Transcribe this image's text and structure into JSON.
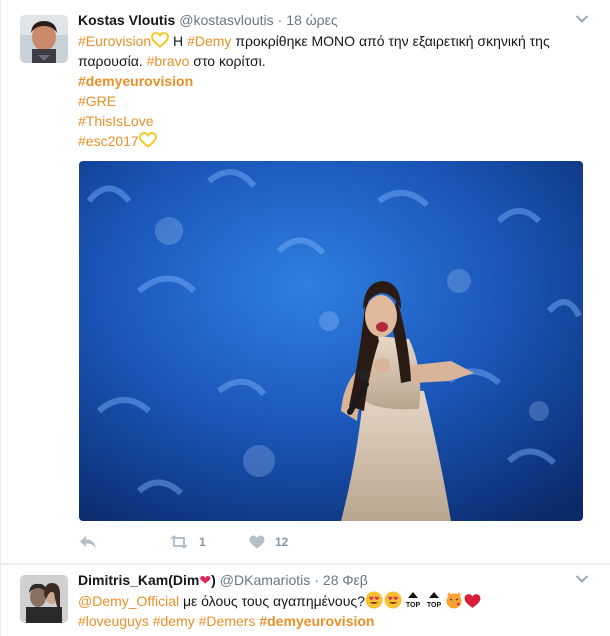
{
  "tweets": [
    {
      "fullname": "Kostas Vloutis",
      "username": "@kostasvloutis",
      "time": "18 ώρες",
      "line1_tag1": "#Eurovision",
      "line1_h": "Η",
      "line1_tag2": "#Demy",
      "line1_rest": "προκρίθηκε ΜΟΝΟ από την εξαιρετική σκηνική της",
      "line2_a": "παρουσία.",
      "line2_tag": "#bravo",
      "line2_rest": "στο κορίτσι.",
      "tag_bold": "#demyeurovision",
      "tag_gre": "#GRE",
      "tag_love": "#ThisIsLove",
      "tag_esc": "#esc2017",
      "reply_count": "",
      "retweet_count": "1",
      "like_count": "12"
    },
    {
      "fullname": "Dimitris_Kam(Dim",
      "fullname_close": ")",
      "username": "@DKamariotis",
      "time": "28 Φεβ",
      "mention": "@Demy_Official",
      "line1_rest": "με όλους τους αγαπημένους?",
      "top_label": "TOP",
      "tag1": "#loveuguys",
      "tag2": "#demy",
      "tag3": "#Demers",
      "tag4": "#demyeurovision"
    }
  ],
  "colors": {
    "hashtag": "#e8902a",
    "muted": "#657786",
    "heart": "#e0245e"
  },
  "icons": [
    "chevron-down-icon",
    "reply-icon",
    "retweet-icon",
    "like-icon"
  ]
}
